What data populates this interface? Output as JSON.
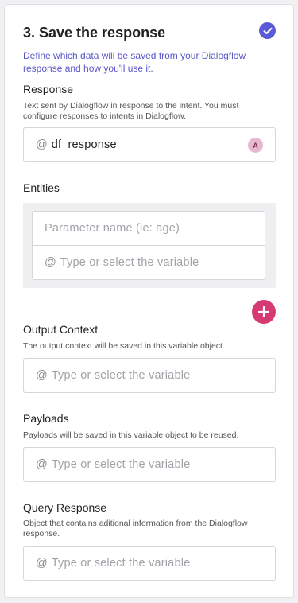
{
  "section": {
    "title": "3. Save the response",
    "description": "Define which data will be saved from your Dialogflow response and how you'll use it."
  },
  "response": {
    "label": "Response",
    "help": "Text sent by Dialogflow in response to the intent. You must configure responses to intents in Dialogflow.",
    "prefix": "@",
    "value": "df_response",
    "badge": "A"
  },
  "entities": {
    "label": "Entities",
    "param_placeholder": "Parameter name (ie: age)",
    "prefix": "@",
    "variable_placeholder": "Type or select the variable"
  },
  "output_context": {
    "label": "Output Context",
    "help": "The output context will be saved in this variable object.",
    "prefix": "@",
    "placeholder": "Type or select the variable"
  },
  "payloads": {
    "label": "Payloads",
    "help": "Payloads will be saved in this variable object to be reused.",
    "prefix": "@",
    "placeholder": "Type or select the variable"
  },
  "query_response": {
    "label": "Query Response",
    "help": "Object that contains aditional information from the Dialogflow response.",
    "prefix": "@",
    "placeholder": "Type or select the variable"
  },
  "colors": {
    "accent": "#5b59d6",
    "add_button": "#d63a73",
    "badge_bg": "#e9b8cf"
  },
  "icons": {
    "completed": "check-circle-icon",
    "add": "plus-icon"
  }
}
